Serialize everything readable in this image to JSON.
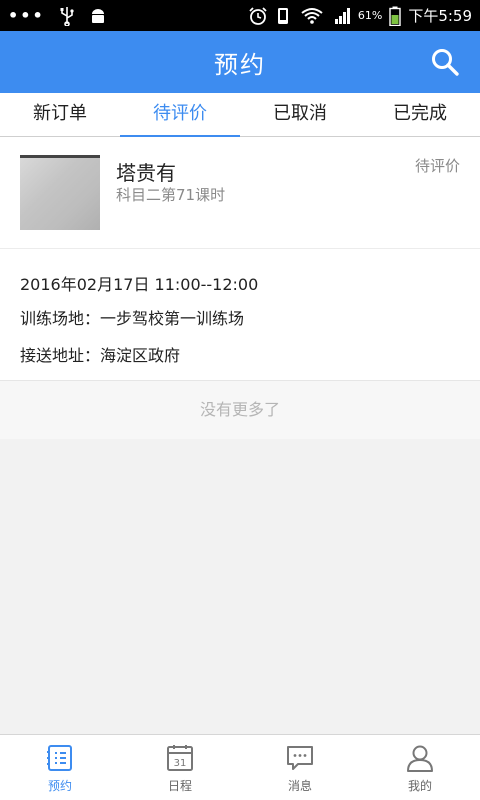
{
  "status_bar": {
    "dots": "•••",
    "battery": "61%",
    "time": "下午5:59"
  },
  "header": {
    "title": "预约",
    "search_icon": "search-icon"
  },
  "tabs": [
    {
      "label": "新订单",
      "active": false
    },
    {
      "label": "待评价",
      "active": true
    },
    {
      "label": "已取消",
      "active": false
    },
    {
      "label": "已完成",
      "active": false
    }
  ],
  "order": {
    "student_name": "塔贵有",
    "lesson": "科目二第71课时",
    "status": "待评价",
    "datetime": "2016年02月17日 11:00--12:00",
    "venue": "训练场地：一步驾校第一训练场",
    "pickup": "接送地址：海淀区政府"
  },
  "list_footer": "没有更多了",
  "bottom_nav": [
    {
      "label": "预约",
      "icon": "booking-icon",
      "active": true
    },
    {
      "label": "日程",
      "icon": "calendar-icon",
      "active": false
    },
    {
      "label": "消息",
      "icon": "message-icon",
      "active": false
    },
    {
      "label": "我的",
      "icon": "profile-icon",
      "active": false
    }
  ],
  "colors": {
    "accent": "#3d8cf0",
    "text_primary": "#222222",
    "text_secondary": "#8a8a8a"
  }
}
